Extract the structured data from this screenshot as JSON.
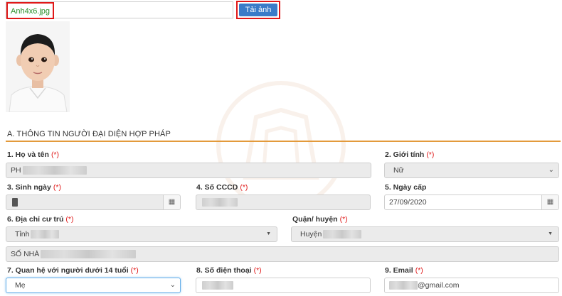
{
  "upload": {
    "file_name": "Anh4x6.jpg",
    "button_label": "Tải ảnh"
  },
  "section": {
    "title": "A. THÔNG TIN NGƯỜI ĐẠI DIỆN HỢP PHÁP"
  },
  "required_mark": "(*)",
  "fields": {
    "full_name": {
      "label": "1. Họ và tên",
      "value": "PH"
    },
    "gender": {
      "label": "2. Giới tính",
      "value": "Nữ"
    },
    "birth_date": {
      "label": "3. Sinh ngày",
      "value": ""
    },
    "id_number": {
      "label": "4. Số CCCD",
      "value": ""
    },
    "issue_date": {
      "label": "5. Ngày cấp",
      "value": "27/09/2020"
    },
    "address": {
      "label": "6. Địa chỉ cư trú",
      "province": "Tỉnh",
      "street": "SỐ NHÀ"
    },
    "district": {
      "label": "Quận/ huyện",
      "value": "Huyện"
    },
    "relation": {
      "label": "7. Quan hệ với người dưới 14 tuổi",
      "value": "Mẹ"
    },
    "phone": {
      "label": "8. Số điện thoại",
      "value": ""
    },
    "email": {
      "label": "9. Email",
      "value": "@gmail.com"
    }
  },
  "icons": {
    "calendar": "calendar-icon",
    "dropdown": "chevron-down-icon"
  }
}
